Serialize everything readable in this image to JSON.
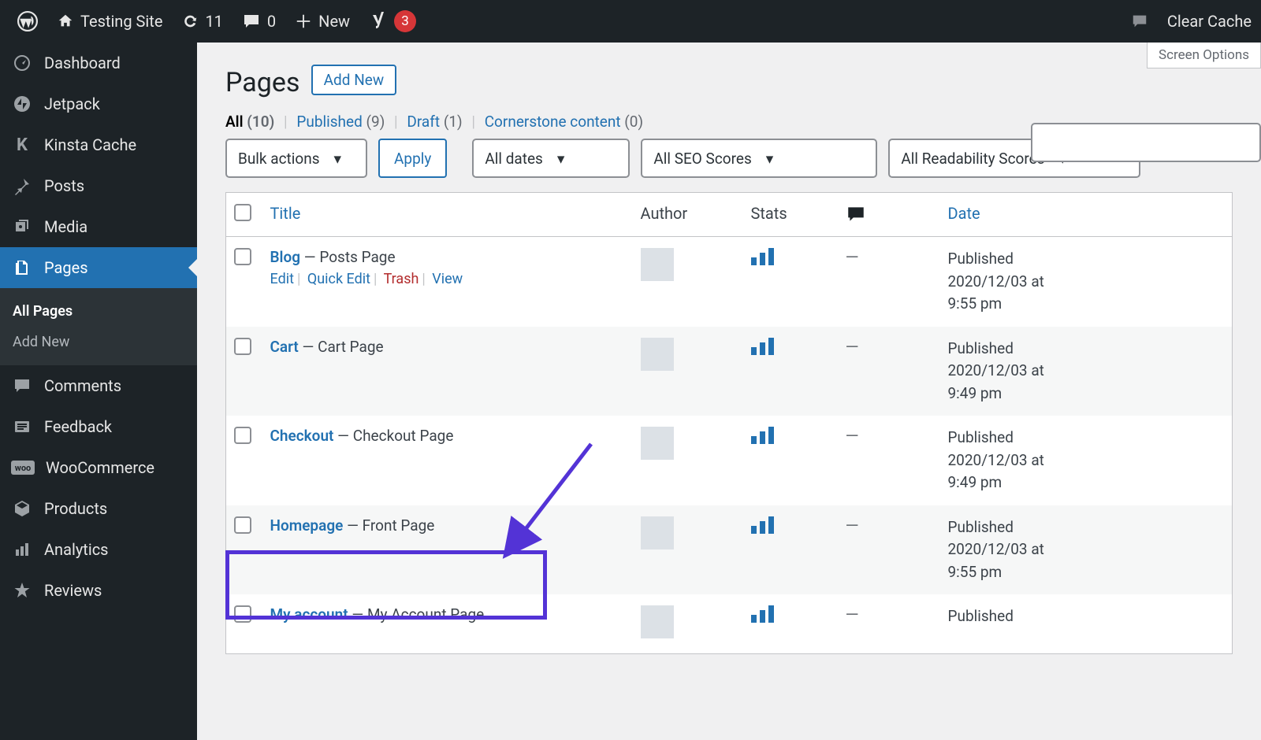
{
  "toolbar": {
    "site_name": "Testing Site",
    "updates_count": "11",
    "comments_count": "0",
    "new_label": "New",
    "yoast_count": "3",
    "clear_cache": "Clear Cache"
  },
  "sidebar": {
    "items": [
      {
        "id": "dashboard",
        "label": "Dashboard",
        "icon": "gauge"
      },
      {
        "id": "jetpack",
        "label": "Jetpack",
        "icon": "jetpack"
      },
      {
        "id": "kinsta",
        "label": "Kinsta Cache",
        "icon": "kinsta"
      },
      {
        "id": "posts",
        "label": "Posts",
        "icon": "pin"
      },
      {
        "id": "media",
        "label": "Media",
        "icon": "media"
      },
      {
        "id": "pages",
        "label": "Pages",
        "icon": "pages",
        "active": true
      },
      {
        "id": "comments",
        "label": "Comments",
        "icon": "comment"
      },
      {
        "id": "feedback",
        "label": "Feedback",
        "icon": "feedback"
      },
      {
        "id": "woocommerce",
        "label": "WooCommerce",
        "icon": "woo"
      },
      {
        "id": "products",
        "label": "Products",
        "icon": "box"
      },
      {
        "id": "analytics",
        "label": "Analytics",
        "icon": "bars"
      },
      {
        "id": "reviews",
        "label": "Reviews",
        "icon": "star"
      }
    ],
    "submenu": {
      "all_pages": "All Pages",
      "add_new": "Add New"
    }
  },
  "content": {
    "screen_options": "Screen Options",
    "heading": "Pages",
    "add_new": "Add New",
    "status_links": {
      "all": {
        "label": "All",
        "count": "(10)"
      },
      "published": {
        "label": "Published",
        "count": "(9)"
      },
      "draft": {
        "label": "Draft",
        "count": "(1)"
      },
      "cornerstone": {
        "label": "Cornerstone content",
        "count": "(0)"
      }
    },
    "filters": {
      "bulk": "Bulk actions",
      "apply": "Apply",
      "dates": "All dates",
      "seo": "All SEO Scores",
      "readability": "All Readability Scores"
    },
    "table": {
      "headers": {
        "title": "Title",
        "author": "Author",
        "stats": "Stats",
        "date": "Date"
      },
      "row_actions": {
        "edit": "Edit",
        "quick_edit": "Quick Edit",
        "trash": "Trash",
        "view": "View"
      },
      "rows": [
        {
          "title": "Blog",
          "suffix": "Posts Page",
          "date_status": "Published",
          "date_line": "2020/12/03 at 9:55 pm",
          "show_actions": true
        },
        {
          "title": "Cart",
          "suffix": "Cart Page",
          "date_status": "Published",
          "date_line": "2020/12/03 at 9:49 pm"
        },
        {
          "title": "Checkout",
          "suffix": "Checkout Page",
          "date_status": "Published",
          "date_line": "2020/12/03 at 9:49 pm"
        },
        {
          "title": "Homepage",
          "suffix": "Front Page",
          "date_status": "Published",
          "date_line": "2020/12/03 at 9:55 pm"
        },
        {
          "title": "My account",
          "suffix": "My Account Page",
          "date_status": "Published",
          "date_line": ""
        }
      ]
    }
  }
}
